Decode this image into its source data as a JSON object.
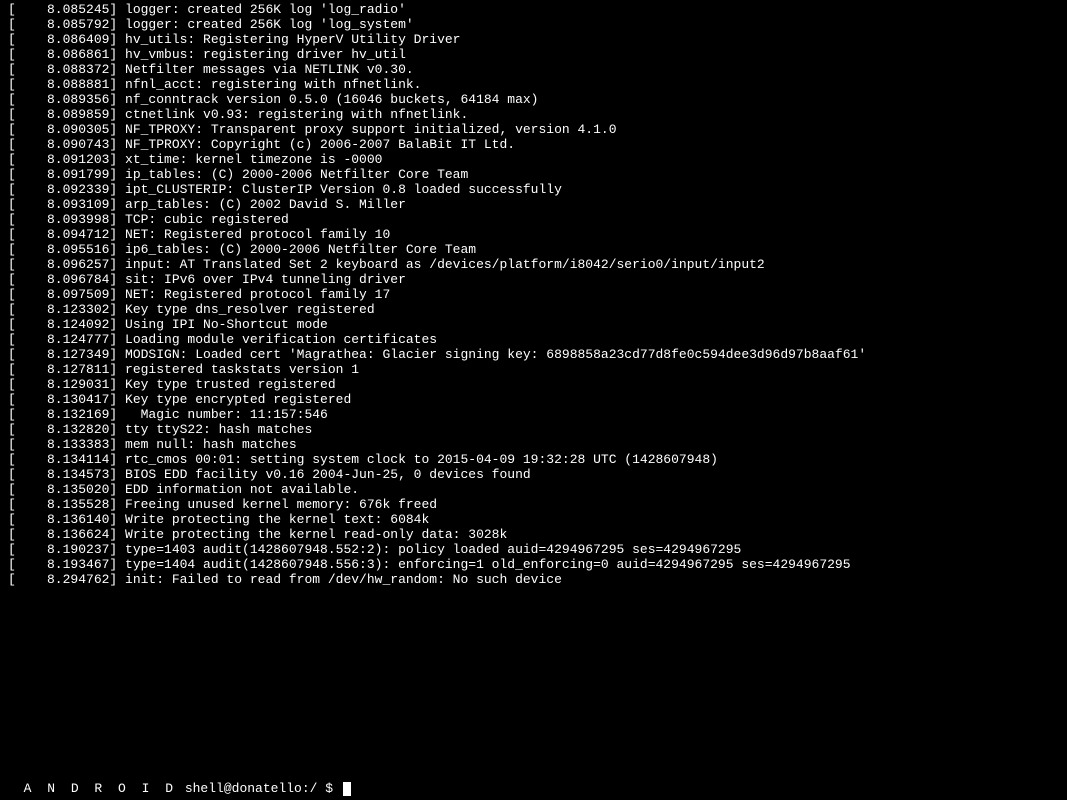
{
  "log_lines": [
    "[    8.085245] logger: created 256K log 'log_radio'",
    "[    8.085792] logger: created 256K log 'log_system'",
    "[    8.086409] hv_utils: Registering HyperV Utility Driver",
    "[    8.086861] hv_vmbus: registering driver hv_util",
    "[    8.088372] Netfilter messages via NETLINK v0.30.",
    "[    8.088881] nfnl_acct: registering with nfnetlink.",
    "[    8.089356] nf_conntrack version 0.5.0 (16046 buckets, 64184 max)",
    "[    8.089859] ctnetlink v0.93: registering with nfnetlink.",
    "[    8.090305] NF_TPROXY: Transparent proxy support initialized, version 4.1.0",
    "[    8.090743] NF_TPROXY: Copyright (c) 2006-2007 BalaBit IT Ltd.",
    "[    8.091203] xt_time: kernel timezone is -0000",
    "[    8.091799] ip_tables: (C) 2000-2006 Netfilter Core Team",
    "[    8.092339] ipt_CLUSTERIP: ClusterIP Version 0.8 loaded successfully",
    "[    8.093109] arp_tables: (C) 2002 David S. Miller",
    "[    8.093998] TCP: cubic registered",
    "[    8.094712] NET: Registered protocol family 10",
    "[    8.095516] ip6_tables: (C) 2000-2006 Netfilter Core Team",
    "[    8.096257] input: AT Translated Set 2 keyboard as /devices/platform/i8042/serio0/input/input2",
    "[    8.096784] sit: IPv6 over IPv4 tunneling driver",
    "[    8.097509] NET: Registered protocol family 17",
    "[    8.123302] Key type dns_resolver registered",
    "[    8.124092] Using IPI No-Shortcut mode",
    "[    8.124777] Loading module verification certificates",
    "[    8.127349] MODSIGN: Loaded cert 'Magrathea: Glacier signing key: 6898858a23cd77d8fe0c594dee3d96d97b8aaf61'",
    "[    8.127811] registered taskstats version 1",
    "[    8.129031] Key type trusted registered",
    "[    8.130417] Key type encrypted registered",
    "[    8.132169]   Magic number: 11:157:546",
    "[    8.132820] tty ttyS22: hash matches",
    "[    8.133383] mem null: hash matches",
    "[    8.134114] rtc_cmos 00:01: setting system clock to 2015-04-09 19:32:28 UTC (1428607948)",
    "[    8.134573] BIOS EDD facility v0.16 2004-Jun-25, 0 devices found",
    "[    8.135020] EDD information not available.",
    "[    8.135528] Freeing unused kernel memory: 676k freed",
    "[    8.136140] Write protecting the kernel text: 6084k",
    "[    8.136624] Write protecting the kernel read-only data: 3028k",
    "[    8.190237] type=1403 audit(1428607948.552:2): policy loaded auid=4294967295 ses=4294967295",
    "[    8.193467] type=1404 audit(1428607948.556:3): enforcing=1 old_enforcing=0 auid=4294967295 ses=4294967295",
    "[    8.294762] init: Failed to read from /dev/hw_random: No such device"
  ],
  "prompt": {
    "label": "A N D R O I D",
    "shell": " shell@donatello:/ $ "
  }
}
